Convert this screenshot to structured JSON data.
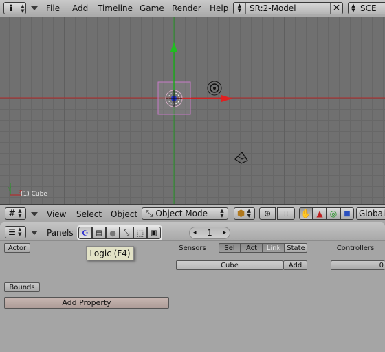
{
  "topbar": {
    "info_label": "i",
    "menus": [
      "File",
      "Add",
      "Timeline",
      "Game",
      "Render",
      "Help"
    ],
    "screen_name": "SR:2-Model",
    "scene_name": "SCE"
  },
  "viewport": {
    "object_label": "(1) Cube"
  },
  "view_header": {
    "menus": [
      "View",
      "Select",
      "Object"
    ],
    "mode": "Object Mode",
    "orientation": "Global"
  },
  "buttons_window": {
    "panels_label": "Panels",
    "frame_value": "1",
    "tooltip": "Logic (F4)",
    "actor_button": "Actor",
    "bounds_button": "Bounds",
    "add_property_button": "Add Property",
    "sensors_label": "Sensors",
    "sensor_filters": [
      "Sel",
      "Act",
      "Link",
      "State"
    ],
    "object_name": "Cube",
    "add_button": "Add",
    "controllers_label": "Controllers",
    "controller_field": "0"
  },
  "colors": {
    "x_axis": "#c02020",
    "y_axis": "#20a020",
    "cube_outline": "#c87cc8"
  }
}
